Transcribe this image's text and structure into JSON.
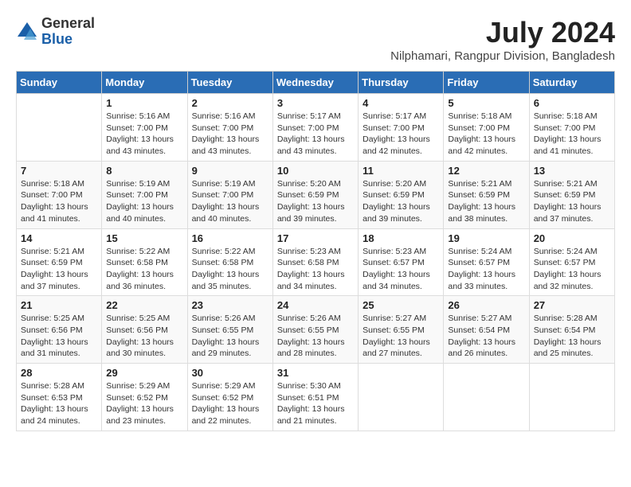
{
  "logo": {
    "general": "General",
    "blue": "Blue"
  },
  "title": {
    "month_year": "July 2024",
    "location": "Nilphamari, Rangpur Division, Bangladesh"
  },
  "calendar": {
    "headers": [
      "Sunday",
      "Monday",
      "Tuesday",
      "Wednesday",
      "Thursday",
      "Friday",
      "Saturday"
    ],
    "weeks": [
      [
        {
          "day": "",
          "info": ""
        },
        {
          "day": "1",
          "info": "Sunrise: 5:16 AM\nSunset: 7:00 PM\nDaylight: 13 hours\nand 43 minutes."
        },
        {
          "day": "2",
          "info": "Sunrise: 5:16 AM\nSunset: 7:00 PM\nDaylight: 13 hours\nand 43 minutes."
        },
        {
          "day": "3",
          "info": "Sunrise: 5:17 AM\nSunset: 7:00 PM\nDaylight: 13 hours\nand 43 minutes."
        },
        {
          "day": "4",
          "info": "Sunrise: 5:17 AM\nSunset: 7:00 PM\nDaylight: 13 hours\nand 42 minutes."
        },
        {
          "day": "5",
          "info": "Sunrise: 5:18 AM\nSunset: 7:00 PM\nDaylight: 13 hours\nand 42 minutes."
        },
        {
          "day": "6",
          "info": "Sunrise: 5:18 AM\nSunset: 7:00 PM\nDaylight: 13 hours\nand 41 minutes."
        }
      ],
      [
        {
          "day": "7",
          "info": "Sunrise: 5:18 AM\nSunset: 7:00 PM\nDaylight: 13 hours\nand 41 minutes."
        },
        {
          "day": "8",
          "info": "Sunrise: 5:19 AM\nSunset: 7:00 PM\nDaylight: 13 hours\nand 40 minutes."
        },
        {
          "day": "9",
          "info": "Sunrise: 5:19 AM\nSunset: 7:00 PM\nDaylight: 13 hours\nand 40 minutes."
        },
        {
          "day": "10",
          "info": "Sunrise: 5:20 AM\nSunset: 6:59 PM\nDaylight: 13 hours\nand 39 minutes."
        },
        {
          "day": "11",
          "info": "Sunrise: 5:20 AM\nSunset: 6:59 PM\nDaylight: 13 hours\nand 39 minutes."
        },
        {
          "day": "12",
          "info": "Sunrise: 5:21 AM\nSunset: 6:59 PM\nDaylight: 13 hours\nand 38 minutes."
        },
        {
          "day": "13",
          "info": "Sunrise: 5:21 AM\nSunset: 6:59 PM\nDaylight: 13 hours\nand 37 minutes."
        }
      ],
      [
        {
          "day": "14",
          "info": "Sunrise: 5:21 AM\nSunset: 6:59 PM\nDaylight: 13 hours\nand 37 minutes."
        },
        {
          "day": "15",
          "info": "Sunrise: 5:22 AM\nSunset: 6:58 PM\nDaylight: 13 hours\nand 36 minutes."
        },
        {
          "day": "16",
          "info": "Sunrise: 5:22 AM\nSunset: 6:58 PM\nDaylight: 13 hours\nand 35 minutes."
        },
        {
          "day": "17",
          "info": "Sunrise: 5:23 AM\nSunset: 6:58 PM\nDaylight: 13 hours\nand 34 minutes."
        },
        {
          "day": "18",
          "info": "Sunrise: 5:23 AM\nSunset: 6:57 PM\nDaylight: 13 hours\nand 34 minutes."
        },
        {
          "day": "19",
          "info": "Sunrise: 5:24 AM\nSunset: 6:57 PM\nDaylight: 13 hours\nand 33 minutes."
        },
        {
          "day": "20",
          "info": "Sunrise: 5:24 AM\nSunset: 6:57 PM\nDaylight: 13 hours\nand 32 minutes."
        }
      ],
      [
        {
          "day": "21",
          "info": "Sunrise: 5:25 AM\nSunset: 6:56 PM\nDaylight: 13 hours\nand 31 minutes."
        },
        {
          "day": "22",
          "info": "Sunrise: 5:25 AM\nSunset: 6:56 PM\nDaylight: 13 hours\nand 30 minutes."
        },
        {
          "day": "23",
          "info": "Sunrise: 5:26 AM\nSunset: 6:55 PM\nDaylight: 13 hours\nand 29 minutes."
        },
        {
          "day": "24",
          "info": "Sunrise: 5:26 AM\nSunset: 6:55 PM\nDaylight: 13 hours\nand 28 minutes."
        },
        {
          "day": "25",
          "info": "Sunrise: 5:27 AM\nSunset: 6:55 PM\nDaylight: 13 hours\nand 27 minutes."
        },
        {
          "day": "26",
          "info": "Sunrise: 5:27 AM\nSunset: 6:54 PM\nDaylight: 13 hours\nand 26 minutes."
        },
        {
          "day": "27",
          "info": "Sunrise: 5:28 AM\nSunset: 6:54 PM\nDaylight: 13 hours\nand 25 minutes."
        }
      ],
      [
        {
          "day": "28",
          "info": "Sunrise: 5:28 AM\nSunset: 6:53 PM\nDaylight: 13 hours\nand 24 minutes."
        },
        {
          "day": "29",
          "info": "Sunrise: 5:29 AM\nSunset: 6:52 PM\nDaylight: 13 hours\nand 23 minutes."
        },
        {
          "day": "30",
          "info": "Sunrise: 5:29 AM\nSunset: 6:52 PM\nDaylight: 13 hours\nand 22 minutes."
        },
        {
          "day": "31",
          "info": "Sunrise: 5:30 AM\nSunset: 6:51 PM\nDaylight: 13 hours\nand 21 minutes."
        },
        {
          "day": "",
          "info": ""
        },
        {
          "day": "",
          "info": ""
        },
        {
          "day": "",
          "info": ""
        }
      ]
    ]
  }
}
